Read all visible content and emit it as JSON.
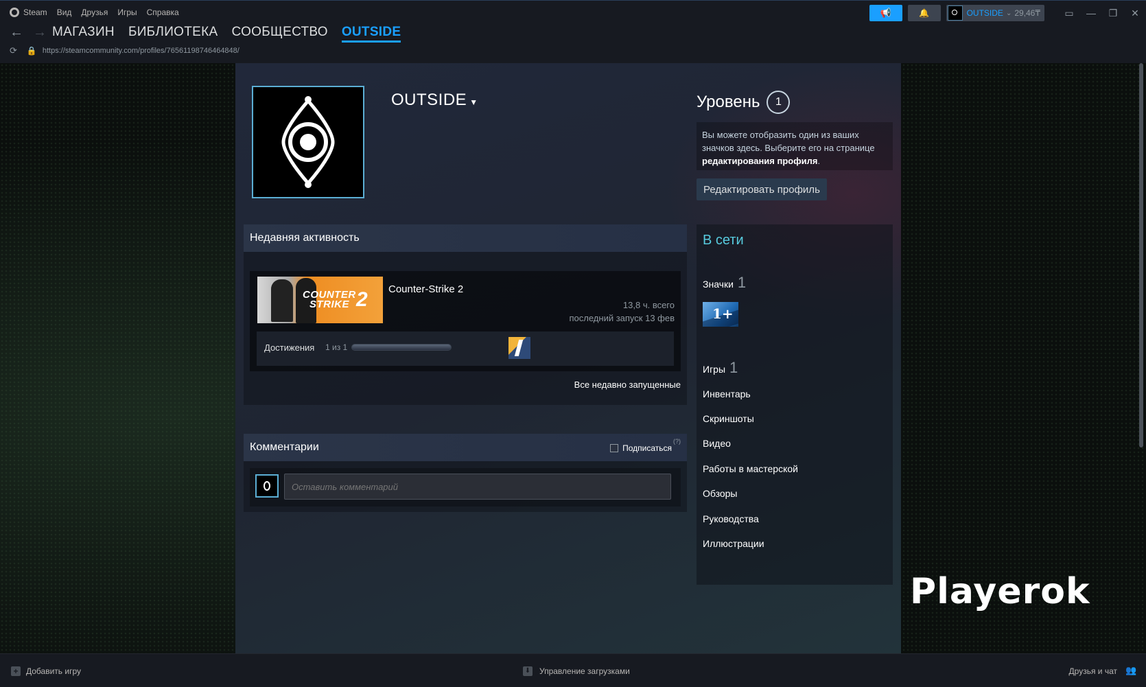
{
  "menubar": {
    "app": "Steam",
    "items": [
      "Вид",
      "Друзья",
      "Игры",
      "Справка"
    ]
  },
  "account": {
    "name": "OUTSIDE",
    "balance": "29,46₸"
  },
  "nav": {
    "tabs": [
      "МАГАЗИН",
      "БИБЛИОТЕКА",
      "СООБЩЕСТВО",
      "OUTSIDE"
    ],
    "active_tab": "OUTSIDE",
    "url": "https://steamcommunity.com/profiles/76561198746464848/"
  },
  "profile": {
    "name": "OUTSIDE",
    "level_label": "Уровень",
    "level": "1",
    "badge_note_1": "Вы можете отобразить один из ваших значков здесь. Выберите его на странице ",
    "badge_note_bold": "редактирования профиля",
    "badge_note_end": ".",
    "edit_button": "Редактировать профиль"
  },
  "activity": {
    "title": "Недавняя активность",
    "game": {
      "name": "Counter-Strike 2",
      "capsule_text_1": "COUNTER",
      "capsule_text_2": "STRIKE",
      "capsule_num": "2",
      "hours": "13,8 ч. всего",
      "last_played": "последний запуск 13 фев",
      "achievements_label": "Достижения",
      "achievements_count": "1 из 1",
      "achievements_progress": 1.0
    },
    "view_all": "Все недавно запущенные"
  },
  "comments": {
    "title": "Комментарии",
    "subscribe": "Подписаться",
    "help": "(?)",
    "placeholder": "Оставить комментарий"
  },
  "sidebar": {
    "status": "В сети",
    "badges_label": "Значки",
    "badges_count": "1",
    "badge_tile": "1+",
    "games_label": "Игры",
    "games_count": "1",
    "links": [
      "Инвентарь",
      "Скриншоты",
      "Видео",
      "Работы в мастерской",
      "Обзоры",
      "Руководства",
      "Иллюстрации"
    ]
  },
  "watermark": "Playerok",
  "bottombar": {
    "add_game": "Добавить игру",
    "downloads": "Управление загрузками",
    "friends": "Друзья и чат"
  },
  "colors": {
    "accent": "#1a9fff",
    "online": "#57cbde"
  }
}
